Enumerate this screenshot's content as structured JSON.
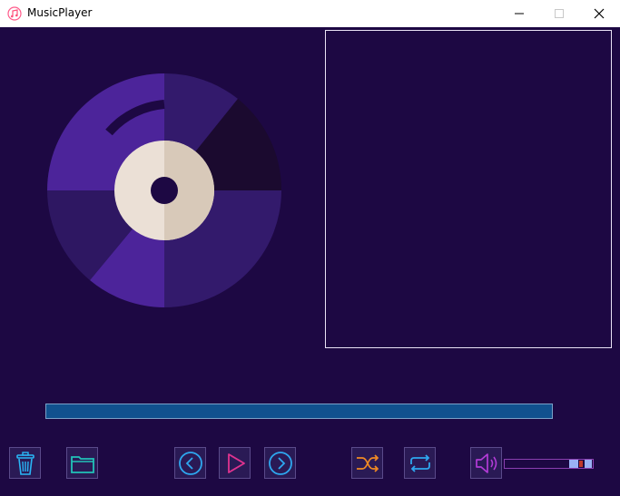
{
  "window": {
    "title": "MusicPlayer",
    "app_icon": "music-note-icon",
    "minimize_icon": "minimize-icon",
    "maximize_icon": "maximize-icon",
    "close_icon": "close-icon"
  },
  "colors": {
    "background": "#1d0843",
    "progress_fill": "#11518f",
    "playlist_border": "#e9e2f5",
    "disc_purple": "#4c249a",
    "disc_dark_purple": "#2e1762",
    "disc_darkest": "#1b0a2f",
    "disc_center_light": "#ebe0d6",
    "disc_center_shadow": "#d8c9b9"
  },
  "controls": {
    "delete_icon": "trash-icon",
    "open_folder_icon": "folder-icon",
    "previous_icon": "chevron-left-circle-icon",
    "play_icon": "play-icon",
    "next_icon": "chevron-right-circle-icon",
    "shuffle_icon": "shuffle-icon",
    "repeat_icon": "repeat-icon",
    "volume_icon": "speaker-icon"
  },
  "playback": {
    "progress": 1.0,
    "volume": 0.75
  },
  "playlist": {
    "items": []
  }
}
